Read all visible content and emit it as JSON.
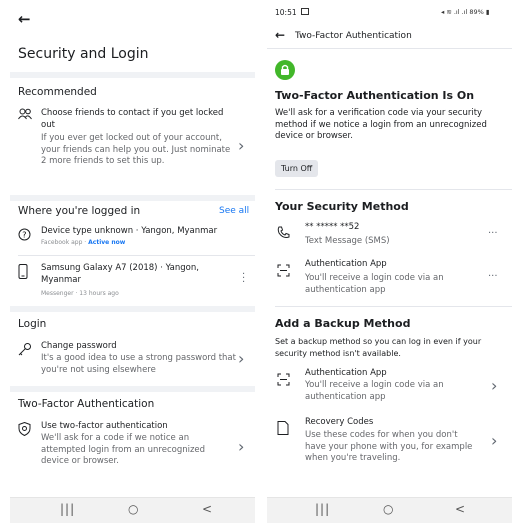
{
  "left": {
    "page_title": "Security and Login",
    "recommended": {
      "header": "Recommended",
      "title": "Choose friends to contact if you get locked out",
      "desc": "If you ever get locked out of your account, your friends can help you out. Just nominate 2 more friends to set this up."
    },
    "logged_in": {
      "header": "Where you're logged in",
      "see_all": "See all",
      "sessions": [
        {
          "device": "Device type unknown · Yangon, Myanmar",
          "app": "Facebook app · ",
          "status": "Active now"
        },
        {
          "device": "Samsung Galaxy A7 (2018) · Yangon, Myanmar",
          "app": "Messenger · 13 hours ago",
          "status": ""
        }
      ]
    },
    "login": {
      "header": "Login",
      "title": "Change password",
      "desc": "It's a good idea to use a strong password that you're not using elsewhere"
    },
    "two_factor": {
      "header": "Two-Factor Authentication",
      "title": "Use two-factor authentication",
      "desc": "We'll ask for a code if we notice an attempted login from an unrecognized device or browser."
    }
  },
  "right": {
    "status_bar": {
      "time": "10:51",
      "right": "89%"
    },
    "header_title": "Two-Factor Authentication",
    "on_title": "Two-Factor Authentication Is On",
    "on_desc": "We'll ask for a verification code via your security method if we notice a login from an unrecognized device or browser.",
    "turn_off": "Turn Off",
    "security_method": {
      "header": "Your Security Method",
      "phone": "** ***** **52",
      "phone_type": "Text Message (SMS)",
      "app_title": "Authentication App",
      "app_desc": "You'll receive a login code via an authentication app",
      "more": "···"
    },
    "backup": {
      "header": "Add a Backup Method",
      "desc": "Set a backup method so you can log in even if your security method isn't available.",
      "app_title": "Authentication App",
      "app_desc": "You'll receive a login code via an authentication app",
      "codes_title": "Recovery Codes",
      "codes_desc": "Use these codes for when you don't have your phone with you, for example when you're traveling."
    }
  },
  "nav": {
    "recents": "|||",
    "home": "○",
    "back": "<"
  },
  "colors": {
    "accent": "#1877f2",
    "green": "#42b72a"
  }
}
